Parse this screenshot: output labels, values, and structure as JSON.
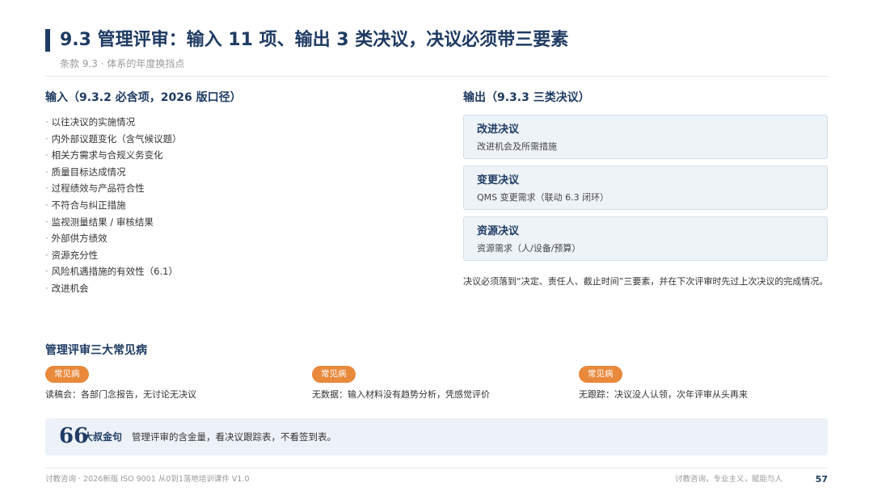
{
  "header": {
    "title": "9.3 管理评审：输入 11 项、输出 3 类决议，决议必须带三要素",
    "subtitle": "条款 9.3 · 体系的年度换挡点"
  },
  "input_section": {
    "heading": "输入（9.3.2 必含项，2026 版口径）",
    "bullet": "·",
    "items": [
      "以往决议的实施情况",
      "内外部议题变化（含气候议题）",
      "相关方需求与合规义务变化",
      "质量目标达成情况",
      "过程绩效与产品符合性",
      "不符合与纠正措施",
      "监视测量结果 / 审核结果",
      "外部供方绩效",
      "资源充分性",
      "风险机遇措施的有效性（6.1）",
      "改进机会"
    ]
  },
  "output_section": {
    "heading": "输出（9.3.3 三类决议）",
    "cards": [
      {
        "title": "改进决议",
        "desc": "改进机会及所需措施"
      },
      {
        "title": "变更决议",
        "desc": "QMS 变更需求（联动 6.3 闭环）"
      },
      {
        "title": "资源决议",
        "desc": "资源需求（人/设备/预算）"
      }
    ],
    "note": "决议必须落到“决定、责任人、截止时间”三要素，并在下次评审时先过上次决议的完成情况。"
  },
  "issues_section": {
    "heading": "管理评审三大常见病",
    "items": [
      {
        "badge": "常见病",
        "text": "读稿会：各部门念报告，无讨论无决议"
      },
      {
        "badge": "常见病",
        "text": "无数据：输入材料没有趋势分析，凭感觉评价"
      },
      {
        "badge": "常见病",
        "text": "无跟踪：决议没人认领，次年评审从头再来"
      }
    ]
  },
  "quote": {
    "icon": "quote-icon",
    "mark": "66",
    "label": "大叔金句",
    "text": "管理评审的含金量，看决议跟踪表，不看签到表。"
  },
  "footer": {
    "left": "讨教咨询 · 2026新版 ISO 9001 从0到1落地培训课件 V1.0",
    "right": "讨教咨询，专业主义，赋能与人",
    "page": "57"
  },
  "colors": {
    "primary": "#1f3b63",
    "badge": "#e9893b",
    "card_bg": "#eef3f8",
    "quote_bg": "#edf2f8"
  }
}
